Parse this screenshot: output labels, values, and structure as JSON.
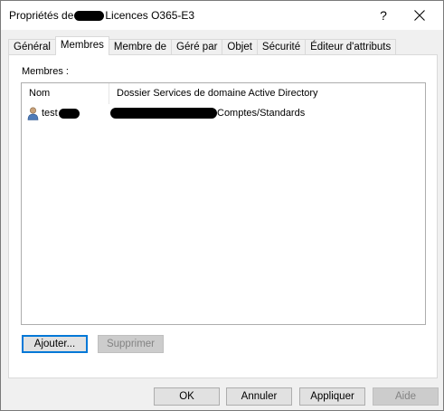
{
  "window": {
    "title_prefix": "Propriétés de",
    "title_suffix": "Licences O365-E3",
    "help_glyph": "?",
    "close_icon": "close-icon"
  },
  "tabs": [
    {
      "label": "Général",
      "active": false
    },
    {
      "label": "Membres",
      "active": true
    },
    {
      "label": "Membre de",
      "active": false
    },
    {
      "label": "Géré par",
      "active": false
    },
    {
      "label": "Objet",
      "active": false
    },
    {
      "label": "Sécurité",
      "active": false
    },
    {
      "label": "Éditeur d'attributs",
      "active": false
    }
  ],
  "members": {
    "label": "Membres :",
    "columns": {
      "name": "Nom",
      "folder": "Dossier Services de domaine Active Directory"
    },
    "rows": [
      {
        "icon": "user-icon",
        "name_prefix": "test",
        "folder_suffix": "Comptes/Standards"
      }
    ],
    "add_button": "Ajouter...",
    "remove_button": "Supprimer"
  },
  "footer": {
    "ok": "OK",
    "cancel": "Annuler",
    "apply": "Appliquer",
    "help": "Aide"
  }
}
